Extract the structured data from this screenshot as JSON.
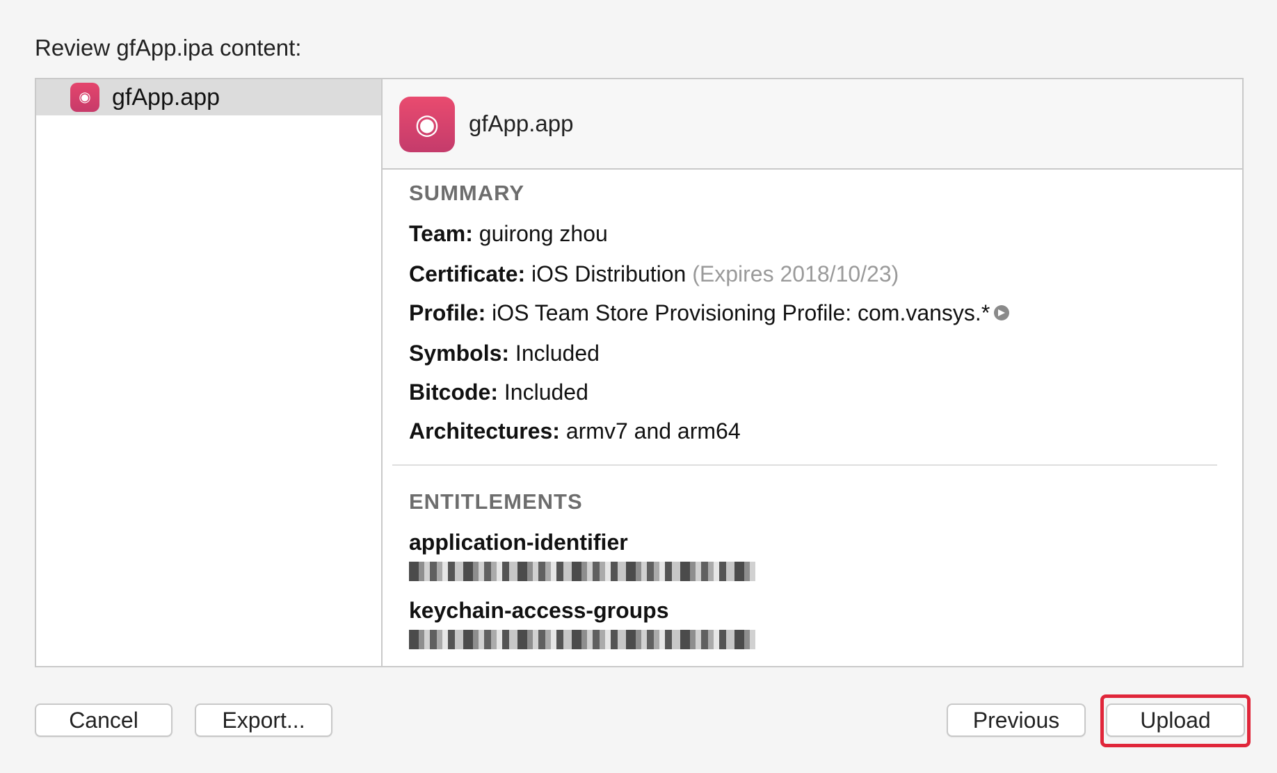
{
  "dialog": {
    "title": "Review gfApp.ipa content:"
  },
  "sidebar": {
    "items": [
      {
        "label": "gfApp.app"
      }
    ]
  },
  "detail": {
    "app_name": "gfApp.app",
    "summary_heading": "SUMMARY",
    "summary": {
      "team_key": "Team:",
      "team_value": "guirong zhou",
      "certificate_key": "Certificate:",
      "certificate_value": "iOS Distribution",
      "certificate_expiry": "(Expires 2018/10/23)",
      "profile_key": "Profile:",
      "profile_value": "iOS Team Store Provisioning Profile: com.vansys.*",
      "symbols_key": "Symbols:",
      "symbols_value": "Included",
      "bitcode_key": "Bitcode:",
      "bitcode_value": "Included",
      "architectures_key": "Architectures:",
      "architectures_value": "armv7 and arm64"
    },
    "entitlements_heading": "ENTITLEMENTS",
    "entitlements": [
      {
        "key": "application-identifier"
      },
      {
        "key": "keychain-access-groups"
      }
    ]
  },
  "buttons": {
    "cancel": "Cancel",
    "export": "Export...",
    "previous": "Previous",
    "upload": "Upload"
  },
  "colors": {
    "app_icon": "#d8416b",
    "highlight": "#e0263a"
  }
}
